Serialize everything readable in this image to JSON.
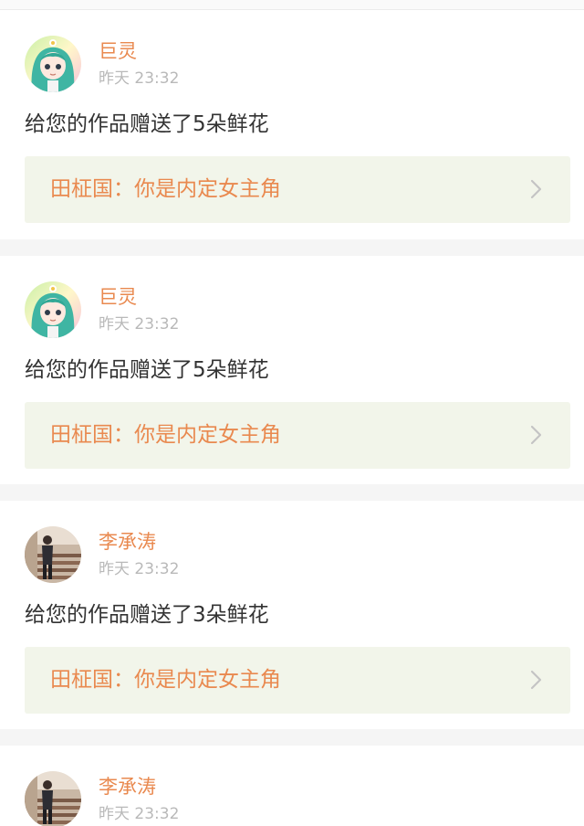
{
  "notifications": [
    {
      "user": "巨灵",
      "avatar_icon": "anime-girl-avatar-icon",
      "time": "昨天 23:32",
      "message": "给您的作品赠送了5朵鲜花",
      "work_title": "田柾国：你是内定女主角"
    },
    {
      "user": "巨灵",
      "avatar_icon": "anime-girl-avatar-icon",
      "time": "昨天 23:32",
      "message": "给您的作品赠送了5朵鲜花",
      "work_title": "田柾国：你是内定女主角"
    },
    {
      "user": "李承涛",
      "avatar_icon": "photo-person-stairs-avatar-icon",
      "time": "昨天 23:32",
      "message": "给您的作品赠送了3朵鲜花",
      "work_title": "田柾国：你是内定女主角"
    },
    {
      "user": "李承涛",
      "avatar_icon": "photo-person-stairs-avatar-icon",
      "time": "昨天 23:32"
    }
  ],
  "colors": {
    "accent": "#e9894f",
    "muted": "#b9b9b9",
    "link_bg": "#f2f5ea",
    "separator": "#f5f5f5"
  }
}
